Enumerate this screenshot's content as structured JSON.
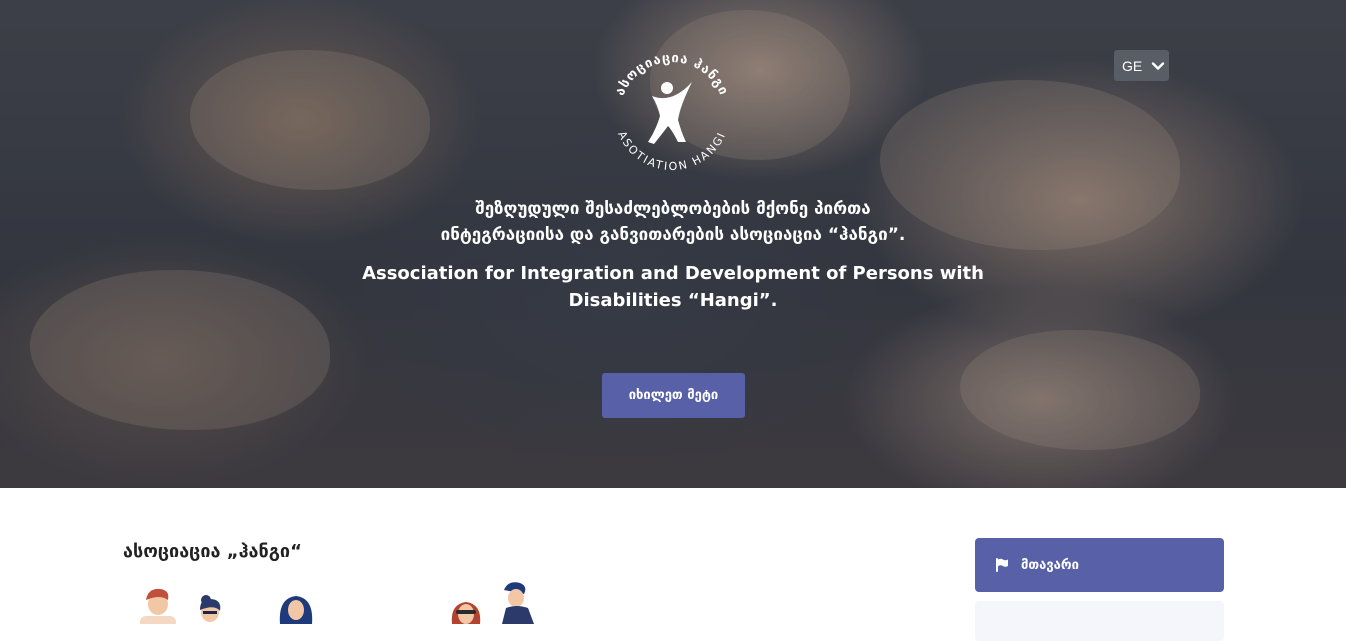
{
  "header": {
    "language_selector": {
      "value": "GE",
      "icon": "chevron-down-icon"
    },
    "logo": {
      "text_top": "ასოციაცია ჰანგი",
      "text_bottom": "ASOTIATION HANGI",
      "icon": "person-figure-logo"
    }
  },
  "hero": {
    "title_ka_line1": "შეზღუდული შესაძლებლობების მქონე პირთა",
    "title_ka_line2": "ინტეგრაციისა და განვითარების ასოციაცია “ჰანგი”.",
    "title_en_line1": "Association for Integration and Development of Persons with",
    "title_en_line2": "Disabilities “Hangi”.",
    "cta_label": "იხილეთ მეტი"
  },
  "main": {
    "section_title": "ასოციაცია „ჰანგი“"
  },
  "sidebar": {
    "items": [
      {
        "label": "მთავარი",
        "icon": "flag-icon",
        "active": true
      }
    ]
  },
  "colors": {
    "accent": "#5860a8",
    "language_bg": "#595d66",
    "sidebar_inactive_bg": "#f4f6fb"
  }
}
